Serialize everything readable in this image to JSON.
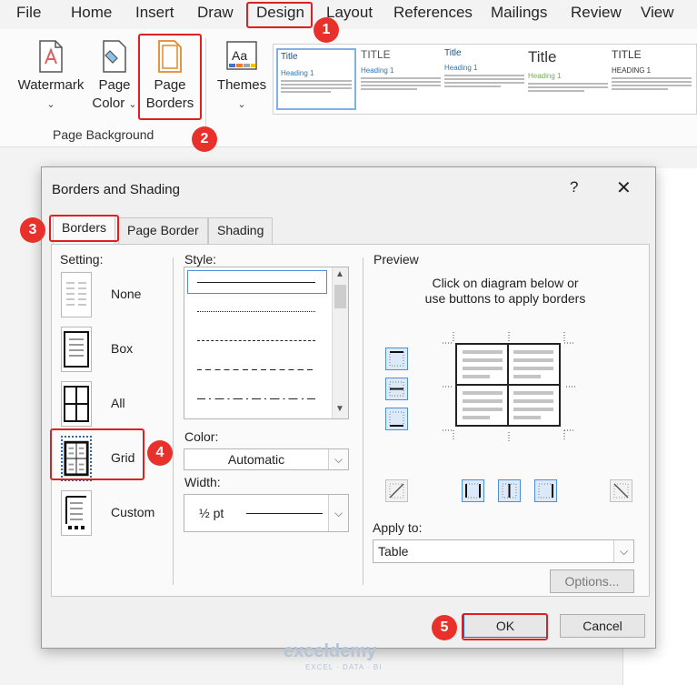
{
  "menu": [
    "File",
    "Home",
    "Insert",
    "Draw",
    "Design",
    "Layout",
    "References",
    "Mailings",
    "Review",
    "View"
  ],
  "ribbon": {
    "watermark": "Watermark",
    "page_color_1": "Page",
    "page_color_2": "Color",
    "page_borders_1": "Page",
    "page_borders_2": "Borders",
    "themes": "Themes",
    "group_label": "Page Background",
    "gallery": [
      {
        "title": "Title",
        "heading": "Heading 1"
      },
      {
        "title": "TITLE",
        "heading": "Heading 1"
      },
      {
        "title": "Title",
        "heading": "Heading 1"
      },
      {
        "title": "Title",
        "heading": "Heading 1"
      },
      {
        "title": "TITLE",
        "heading": "HEADING 1"
      }
    ]
  },
  "dialog": {
    "title": "Borders and Shading",
    "help": "?",
    "close": "✕",
    "tabs": {
      "borders": "Borders",
      "page_border": "Page Border",
      "shading": "Shading"
    },
    "setting_label": "Setting:",
    "settings": {
      "none": "None",
      "box": "Box",
      "all": "All",
      "grid": "Grid",
      "custom": "Custom"
    },
    "style_label": "Style:",
    "color_label": "Color:",
    "color_value": "Automatic",
    "width_label": "Width:",
    "width_value": "½ pt",
    "preview_label": "Preview",
    "preview_hint_1": "Click on diagram below or",
    "preview_hint_2": "use buttons to apply borders",
    "apply_label": "Apply to:",
    "apply_value": "Table",
    "options": "Options...",
    "ok": "OK",
    "cancel": "Cancel"
  },
  "badges": [
    "1",
    "2",
    "3",
    "4",
    "5"
  ],
  "watermark_text": "exceldemy",
  "watermark_sub": "EXCEL · DATA · BI",
  "colors": {
    "highlight": "#e02020",
    "badge": "#e8312b",
    "selected_button": "#dbe9f8"
  }
}
